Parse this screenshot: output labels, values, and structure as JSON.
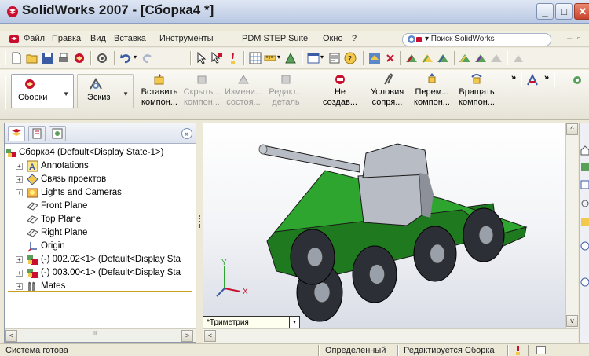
{
  "window": {
    "title": "SolidWorks 2007 - [Сборка4 *]",
    "minimize_glyph": "_",
    "maximize_glyph": "□",
    "close_glyph": "✕"
  },
  "menu": {
    "items": [
      "Файл",
      "Правка",
      "Вид",
      "Вставка",
      "Инструменты",
      "PDM STEP Suite",
      "Окно",
      "?"
    ],
    "search_label": "▾ Поиск SolidWorks",
    "mdi_min": "–",
    "mdi_restore": "▫"
  },
  "command_manager": {
    "tabs": [
      {
        "label": "Сборки"
      },
      {
        "label": "Эскиз"
      }
    ],
    "commands": [
      {
        "line1": "Вставить",
        "line2": "компон...",
        "enabled": true
      },
      {
        "line1": "Скрыть...",
        "line2": "компон...",
        "enabled": false
      },
      {
        "line1": "Измени...",
        "line2": "состоя...",
        "enabled": false
      },
      {
        "line1": "Редакт...",
        "line2": "деталь",
        "enabled": false
      },
      {
        "line1": "Не",
        "line2": "создав...",
        "enabled": true
      },
      {
        "line1": "Условия",
        "line2": "сопря...",
        "enabled": true
      },
      {
        "line1": "Перем...",
        "line2": "компон...",
        "enabled": true
      },
      {
        "line1": "Вращать",
        "line2": "компон...",
        "enabled": true
      }
    ],
    "overflow": "»"
  },
  "feature_manager": {
    "more_glyph": "»",
    "tree": [
      {
        "label": "Сборка4  (Default<Display State-1>)",
        "icon": "assembly-icon",
        "expander": "",
        "level": 0
      },
      {
        "label": "Annotations",
        "icon": "annotations-icon",
        "expander": "+",
        "level": 1
      },
      {
        "label": "Связь проектов",
        "icon": "design-binder-icon",
        "expander": "+",
        "level": 1
      },
      {
        "label": "Lights and Cameras",
        "icon": "lights-icon",
        "expander": "+",
        "level": 1
      },
      {
        "label": "Front Plane",
        "icon": "plane-icon",
        "expander": "",
        "level": 1
      },
      {
        "label": "Top Plane",
        "icon": "plane-icon",
        "expander": "",
        "level": 1
      },
      {
        "label": "Right Plane",
        "icon": "plane-icon",
        "expander": "",
        "level": 1
      },
      {
        "label": "Origin",
        "icon": "origin-icon",
        "expander": "",
        "level": 1
      },
      {
        "label": "(-) 002.02<1> (Default<Display Sta",
        "icon": "part-icon",
        "expander": "+",
        "level": 1
      },
      {
        "label": "(-) 003.00<1> (Default<Display Sta",
        "icon": "part-icon",
        "expander": "+",
        "level": 1
      },
      {
        "label": "Mates",
        "icon": "mates-icon",
        "expander": "+",
        "level": 1
      }
    ],
    "scroll_left": "<",
    "scroll_right": ">",
    "scroll_grip": "III"
  },
  "viewport": {
    "view_orientation": "*Триметрия",
    "view_dropdown_glyph": "▾",
    "axis_x": "X",
    "axis_y": "Y",
    "scroll_up": "^",
    "scroll_down": "v",
    "scroll_left": "<"
  },
  "colors": {
    "tank_body": "#2ea52e",
    "tank_body_dark": "#1f7a1f",
    "turret": "#b8bcc4",
    "wheel": "#2d2f36",
    "hub": "#9aa0aa"
  },
  "status": {
    "left": "Система готова",
    "defined": "Определенный",
    "editing": "Редактируется Сборка"
  }
}
